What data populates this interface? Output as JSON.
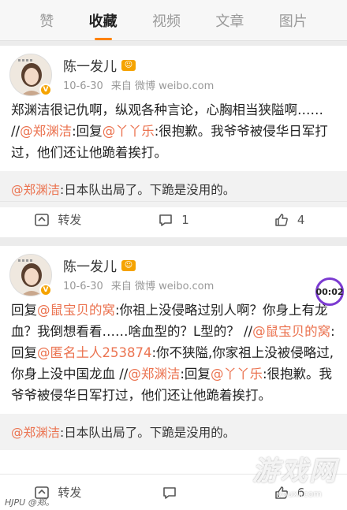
{
  "tabs": [
    {
      "label": "赞"
    },
    {
      "label": "收藏",
      "active": true
    },
    {
      "label": "视频"
    },
    {
      "label": "文章"
    },
    {
      "label": "图片"
    }
  ],
  "posts": [
    {
      "username": "陈一发儿",
      "time": "10-6-30",
      "source": "来自 微博 weibo.com",
      "text_parts": [
        {
          "t": "郑渊洁很记仇啊，纵观各种言论，心胸相当狭隘啊…… //",
          "link": false
        },
        {
          "t": "@郑渊洁",
          "link": true
        },
        {
          "t": ":回复",
          "link": false
        },
        {
          "t": "@丫丫乐",
          "link": true
        },
        {
          "t": ":很抱歉。我爷爷被侵华日军打过，他们还让他跪着挨打。",
          "link": false
        }
      ],
      "retweet_parts": [
        {
          "t": "@郑渊洁",
          "link": true
        },
        {
          "t": ":日本队出局了。下跪是没用的。",
          "link": false
        }
      ],
      "actions": {
        "repost": "转发",
        "comments": "1",
        "likes": "4"
      }
    },
    {
      "username": "陈一发儿",
      "time": "10-6-30",
      "source": "来自 微博 weibo.com",
      "text_parts": [
        {
          "t": "回复",
          "link": false
        },
        {
          "t": "@鼠宝贝的窝",
          "link": true
        },
        {
          "t": ":你祖上没侵略过别人啊？你身上有龙血？我倒想看看……啥血型的？L型的？ //",
          "link": false
        },
        {
          "t": "@鼠宝贝的窝",
          "link": true
        },
        {
          "t": ":回复",
          "link": false
        },
        {
          "t": "@匿名土人253874",
          "link": true
        },
        {
          "t": ":你不狭隘,你家祖上没被侵略过,你身上没中国龙血 //",
          "link": false
        },
        {
          "t": "@郑渊洁",
          "link": true
        },
        {
          "t": ":回复",
          "link": false
        },
        {
          "t": "@丫丫乐",
          "link": true
        },
        {
          "t": ":很抱歉。我爷爷被侵华日军打过，他们还让他跪着挨打。",
          "link": false
        }
      ],
      "retweet_parts": [
        {
          "t": "@郑渊洁",
          "link": true
        },
        {
          "t": ":日本队出局了。下跪是没用的。",
          "link": false
        }
      ],
      "actions": {
        "repost": "转发",
        "comments": "",
        "likes": "6"
      },
      "time_badge": "00:02"
    }
  ],
  "watermark": {
    "main": "游戏网",
    "sub": "youxi.com"
  },
  "footer": "HJPU @郑。",
  "colors": {
    "accent": "#ff8200",
    "link": "#eb7350",
    "vip": "#f5a300"
  },
  "icons": {
    "repost": "repost-icon",
    "comment": "comment-icon",
    "like": "like-icon"
  }
}
